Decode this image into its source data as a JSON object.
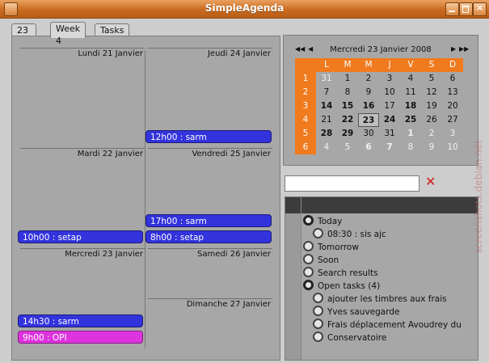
{
  "window": {
    "title": "SimpleAgenda"
  },
  "tabs": [
    "23 Jan",
    "Week 4",
    "Tasks"
  ],
  "week": {
    "days": [
      {
        "label": "Lundi 21 Janvier",
        "events": []
      },
      {
        "label": "Mardi 22 Janvier",
        "events": [
          {
            "text": "10h00 : setap",
            "color": "#3333dd"
          }
        ]
      },
      {
        "label": "Mercredi 23 Janvier",
        "events": [
          {
            "text": "14h30 : sarm",
            "color": "#3333dd"
          },
          {
            "text": "9h00 : OPI",
            "color": "#dd33dd"
          }
        ]
      },
      {
        "label": "Jeudi 24 Janvier",
        "events": [
          {
            "text": "12h00 : sarm",
            "color": "#3333dd"
          }
        ]
      },
      {
        "label": "Vendredi 25 Janvier",
        "events": [
          {
            "text": "17h00 : sarm",
            "color": "#3333dd"
          },
          {
            "text": "8h00 : setap",
            "color": "#3333dd"
          }
        ]
      },
      {
        "label": "Samedi 26 Janvier",
        "events": []
      },
      {
        "label": "Dimanche 27 Janvier",
        "events": []
      }
    ]
  },
  "minical": {
    "prev_year": "◀◀",
    "prev_month": "◀",
    "next_month": "▶",
    "next_year": "▶▶",
    "header": "Mercredi 23 Janvier 2008",
    "weekdays": [
      "L",
      "M",
      "M",
      "J",
      "V",
      "S",
      "D"
    ],
    "weeks": [
      "1",
      "2",
      "3",
      "4",
      "5",
      "6"
    ],
    "days": [
      [
        "31",
        "1",
        "2",
        "3",
        "4",
        "5",
        "6"
      ],
      [
        "7",
        "8",
        "9",
        "10",
        "11",
        "12",
        "13"
      ],
      [
        "14",
        "15",
        "16",
        "17",
        "18",
        "19",
        "20"
      ],
      [
        "21",
        "22",
        "23",
        "24",
        "25",
        "26",
        "27"
      ],
      [
        "28",
        "29",
        "30",
        "31",
        "1",
        "2",
        "3"
      ],
      [
        "4",
        "5",
        "6",
        "7",
        "8",
        "9",
        "10"
      ]
    ],
    "selected": "23"
  },
  "search": {
    "value": "",
    "clear_icon": "✕"
  },
  "tree": {
    "items": [
      {
        "label": "Today",
        "level": 0
      },
      {
        "label": "08:30 : sis ajc",
        "level": 1
      },
      {
        "label": "Tomorrow",
        "level": 0
      },
      {
        "label": "Soon",
        "level": 0
      },
      {
        "label": "Search results",
        "level": 0
      },
      {
        "label": "Open tasks (4)",
        "level": 0
      },
      {
        "label": "ajouter les timbres aux frais",
        "level": 1
      },
      {
        "label": "Yves sauvegarde",
        "level": 1
      },
      {
        "label": "Frais déplacement Avoudrey du",
        "level": 1
      },
      {
        "label": "Conservatoire",
        "level": 1
      }
    ]
  },
  "watermark": "screenshots.debian.net"
}
